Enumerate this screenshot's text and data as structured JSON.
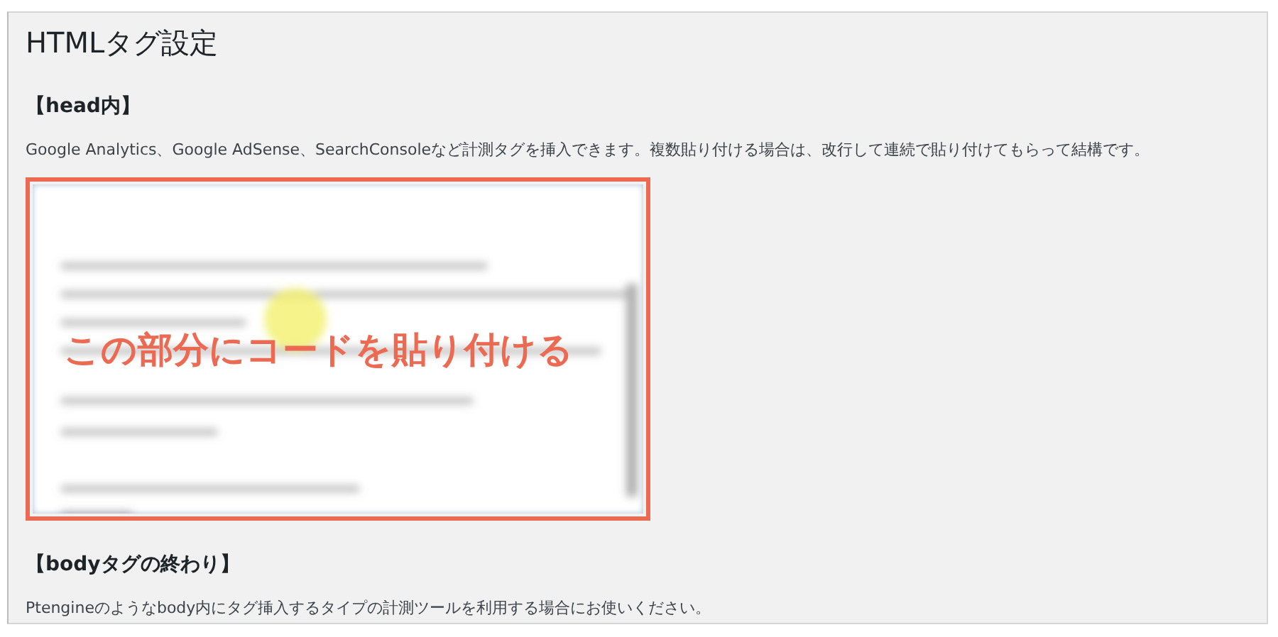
{
  "title": "HTMLタグ設定",
  "sections": [
    {
      "heading": "【head内】",
      "description": "Google Analytics、Google AdSense、SearchConsoleなど計測タグを挿入できます。複数貼り付ける場合は、改行して連続で貼り付けてもらって結構です。",
      "code_field": {
        "annotation": "この部分にコードを貼り付ける"
      }
    },
    {
      "heading": "【bodyタグの終わり】",
      "description": "Ptengineのようなbody内にタグ挿入するタイプの計測ツールを利用する場合にお使いください。"
    }
  ]
}
